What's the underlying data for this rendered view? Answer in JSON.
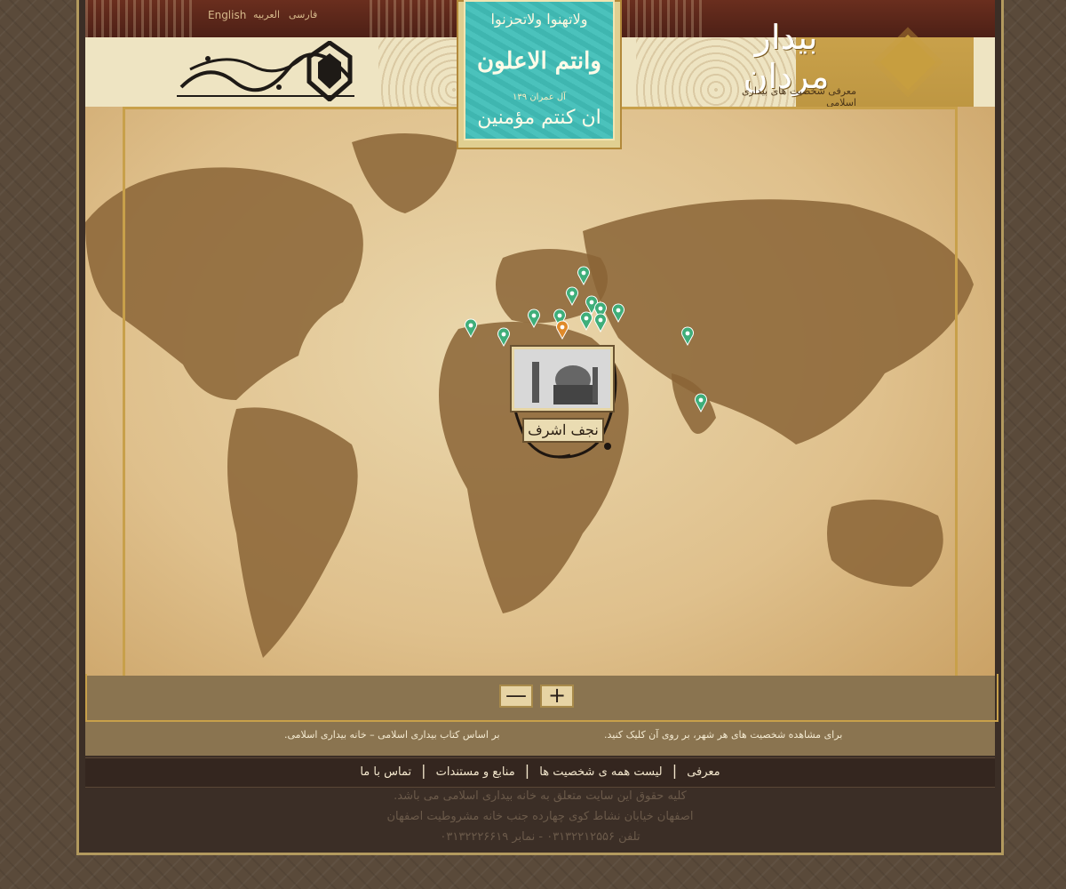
{
  "header": {
    "languages": [
      "English",
      "العربیه",
      "فارسی"
    ],
    "brand_title": "بیدار مردان",
    "brand_subtitle": "معرفی شخصیت های بیداری اسلامی",
    "verse": {
      "line1": "ولاتهنوا ولاتحزنوا",
      "line2": "وانتم الاعلون",
      "line3": "آل عمران ۱۳۹",
      "line4": "ان کنتم مؤمنین"
    },
    "logo_text": "خانه بیداری اسلامی"
  },
  "map": {
    "popup_city": "نجف اشرف",
    "zoom_in_label": "+",
    "zoom_out_label": "—",
    "markers_highlighted": 1,
    "marker_colors": {
      "default": "#3fae7a",
      "active": "#e08a2a"
    }
  },
  "hints": {
    "right": "برای مشاهده شخصیت های هر شهر، بر روی آن کلیک کنید.",
    "left": "بر اساس کتاب بیداری اسلامی – خانه بیداری اسلامی."
  },
  "nav": {
    "items": [
      "معرفی",
      "لیست همه ی شخصیت ها",
      "منابع و مستندات",
      "تماس با ما"
    ]
  },
  "footer": {
    "line1": "کلیه حقوق این سایت متعلق به خانه بیداری اسلامی می باشد.",
    "line2": "اصفهان خیابان نشاط کوی چهارده جنب خانه مشروطیت اصفهان",
    "line3": "تلفن ۰۳۱۳۲۲۱۲۵۵۶ - نمابر ۰۳۱۳۲۲۲۶۶۱۹"
  }
}
